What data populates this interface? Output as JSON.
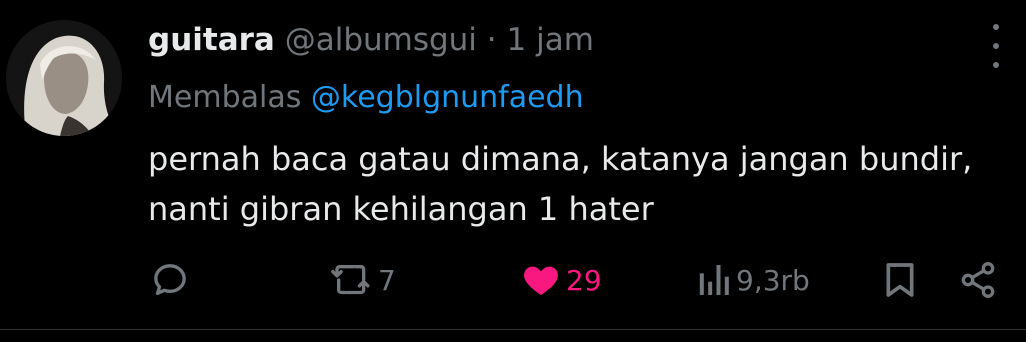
{
  "tweet": {
    "author_name": "guitara",
    "author_handle": "@albumsgui",
    "separator": "·",
    "time": "1 jam",
    "reply_prefix": "Membalas",
    "reply_mention": "@kegblgnunfaedh",
    "text_lines": [
      "pernah baca gatau dimana, katanya jangan bundir,",
      "nanti gibran kehilangan 1 hater"
    ]
  },
  "actions": {
    "reply_count": "",
    "retweet_count": "7",
    "like_count": "29",
    "views_count": "9,3rb"
  },
  "colors": {
    "background": "#000000",
    "text": "#e7e9ea",
    "muted": "#71767b",
    "link": "#1d9bf0",
    "like": "#f91880"
  },
  "icons": [
    "avatar",
    "more-icon",
    "reply-icon",
    "retweet-icon",
    "heart-icon",
    "views-icon",
    "bookmark-icon",
    "share-icon"
  ]
}
